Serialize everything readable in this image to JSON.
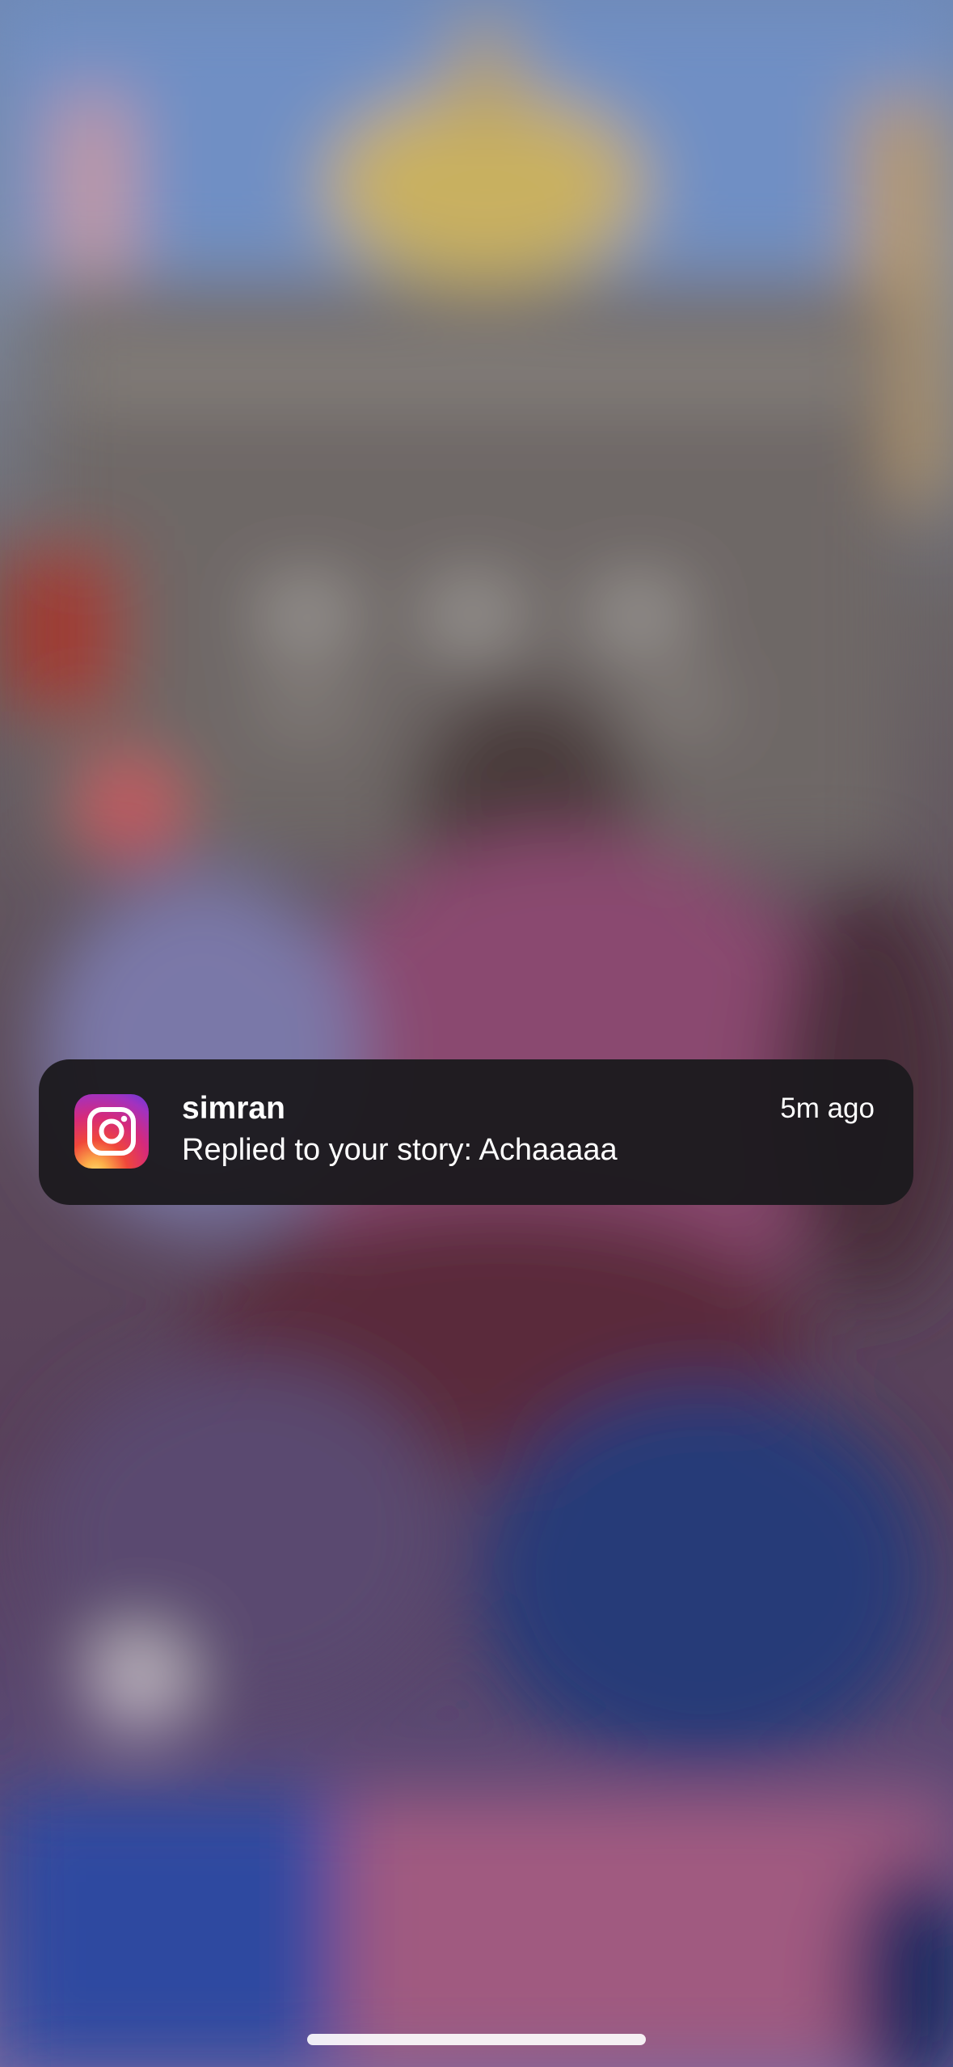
{
  "notification": {
    "app_icon": "instagram-icon",
    "title": "simran",
    "time": "5m ago",
    "body": "Replied to your story: Achaaaaa"
  },
  "colors": {
    "notification_bg": "#1c1a1e",
    "text": "#ffffff"
  }
}
